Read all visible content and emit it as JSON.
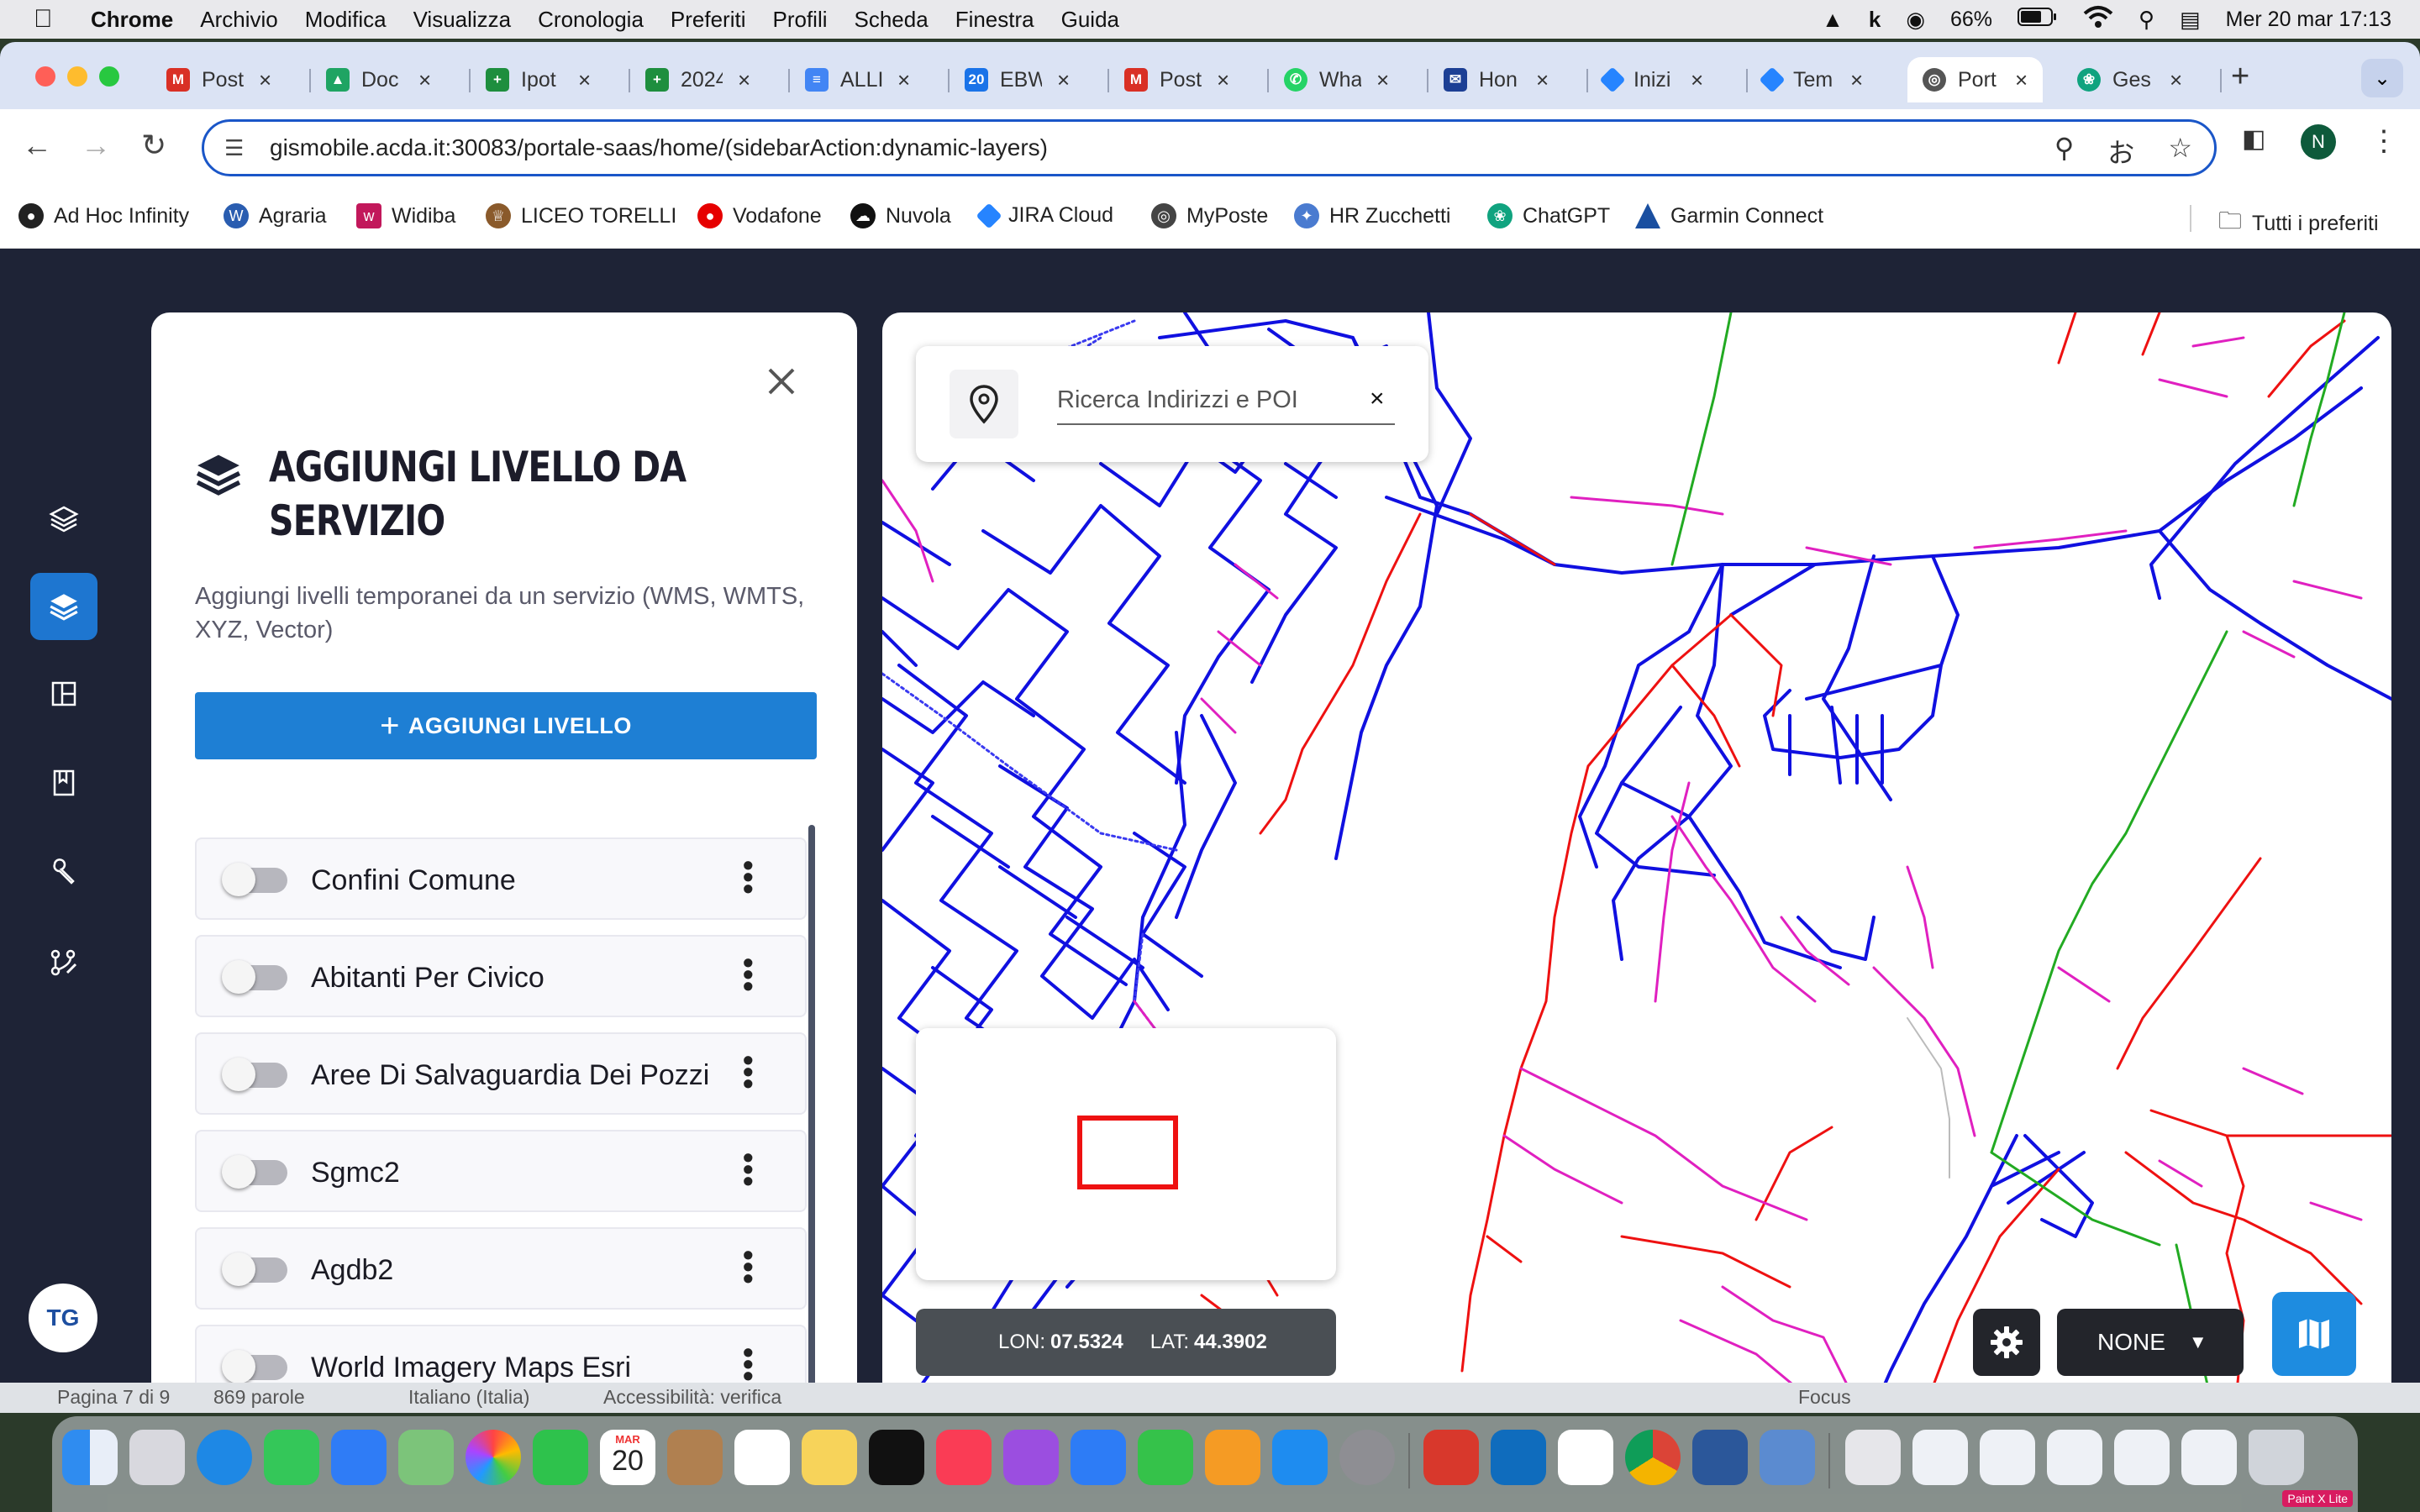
{
  "menubar": {
    "app_name": "Chrome",
    "items": [
      "Archivio",
      "Modifica",
      "Visualizza",
      "Cronologia",
      "Preferiti",
      "Profili",
      "Scheda",
      "Finestra",
      "Guida"
    ],
    "battery": "66%",
    "datetime": "Mer 20 mar  17:13"
  },
  "tabs": [
    {
      "title": "Post",
      "icon": "gmail-icon",
      "color": "#d93025"
    },
    {
      "title": "Doc",
      "icon": "drive-icon",
      "color": "#1fa463"
    },
    {
      "title": "Ipot",
      "icon": "sheets-icon",
      "color": "#1e8e3e"
    },
    {
      "title": "2024",
      "icon": "sheets-icon",
      "color": "#1e8e3e"
    },
    {
      "title": "ALLI",
      "icon": "docs-icon",
      "color": "#4285f4"
    },
    {
      "title": "EBW",
      "icon": "calendar-icon",
      "color": "#1a73e8"
    },
    {
      "title": "Post",
      "icon": "gmail-icon",
      "color": "#d93025"
    },
    {
      "title": "Wha",
      "icon": "whatsapp-icon",
      "color": "#25d366"
    },
    {
      "title": "Hon",
      "icon": "mail-icon",
      "color": "#1c3f94"
    },
    {
      "title": "Inizi",
      "icon": "jira-icon",
      "color": "#2684ff"
    },
    {
      "title": "Tem",
      "icon": "jira-icon",
      "color": "#2684ff"
    },
    {
      "title": "Port",
      "icon": "globe-icon",
      "color": "#555555"
    },
    {
      "title": "Ges",
      "icon": "chatgpt-icon",
      "color": "#10a37f"
    }
  ],
  "address_bar": {
    "url": "gismobile.acda.it:30083/portale-saas/home/(sidebarAction:dynamic-layers)"
  },
  "profile_initial": "N",
  "bookmarks": [
    {
      "label": "Ad Hoc Infinity",
      "color": "#222222"
    },
    {
      "label": "Agraria",
      "color": "#2a5db0"
    },
    {
      "label": "Widiba",
      "color": "#c2185b"
    },
    {
      "label": "LICEO TORELLI",
      "color": "#8a5a2b"
    },
    {
      "label": "Vodafone",
      "color": "#e60000"
    },
    {
      "label": "Nuvola",
      "color": "#111111"
    },
    {
      "label": "JIRA Cloud",
      "color": "#2684ff"
    },
    {
      "label": "MyPoste",
      "color": "#444444"
    },
    {
      "label": "HR Zucchetti",
      "color": "#4a7bd0"
    },
    {
      "label": "ChatGPT",
      "color": "#10a37f"
    },
    {
      "label": "Garmin Connect",
      "color": "#1a4fa0"
    }
  ],
  "bookmarks_all": "Tutti i preferiti",
  "sidebar": {
    "avatar": "TG"
  },
  "panel": {
    "title": "AGGIUNGI LIVELLO DA SERVIZIO",
    "description": "Aggiungi livelli temporanei da un servizio (WMS, WMTS, XYZ, Vector)",
    "add_button": "AGGIUNGI LIVELLO",
    "layers": [
      {
        "name": "Confini Comune",
        "enabled": false
      },
      {
        "name": "Abitanti Per Civico",
        "enabled": false
      },
      {
        "name": "Aree Di Salvaguardia Dei Pozzi",
        "enabled": false
      },
      {
        "name": "Sgmc2",
        "enabled": false
      },
      {
        "name": "Agdb2",
        "enabled": false
      },
      {
        "name": "World Imagery Maps Esri",
        "enabled": false
      }
    ]
  },
  "map": {
    "search_placeholder": "Ricerca Indirizzi e POI",
    "lon_label": "LON:",
    "lon_value": "07.5324",
    "lat_label": "LAT:",
    "lat_value": "44.3902",
    "select_value": "NONE",
    "colors": {
      "main": "#1010e0",
      "red": "#ee1111",
      "magenta": "#e020c0",
      "green": "#22aa22"
    }
  },
  "word_status": {
    "page": "Pagina 7 di 9",
    "words": "869 parole",
    "language": "Italiano (Italia)",
    "accessibility": "Accessibilità: verifica",
    "focus": "Focus"
  },
  "dock": {
    "calendar_month": "MAR",
    "calendar_day": "20",
    "app_badge": "Paint X Lite"
  }
}
